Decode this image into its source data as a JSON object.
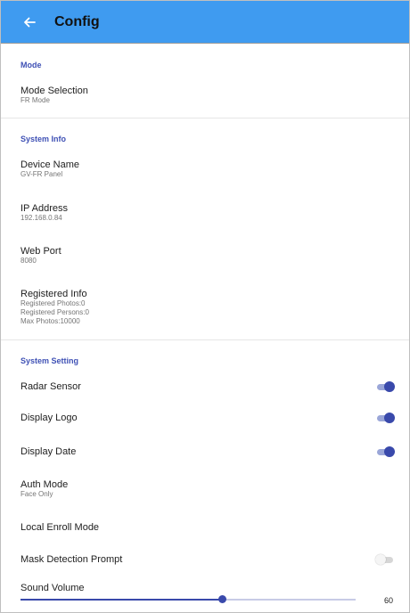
{
  "app_bar": {
    "title": "Config"
  },
  "sections": {
    "mode": {
      "header": "Mode",
      "mode_selection": {
        "title": "Mode Selection",
        "value": "FR Mode"
      }
    },
    "system_info": {
      "header": "System Info",
      "device_name": {
        "title": "Device Name",
        "value": "GV-FR Panel"
      },
      "ip_address": {
        "title": "IP Address",
        "value": "192.168.0.84"
      },
      "web_port": {
        "title": "Web Port",
        "value": "8080"
      },
      "registered_info": {
        "title": "Registered Info",
        "lines": [
          "Registered Photos:0",
          "Registered Persons:0",
          "Max Photos:10000"
        ]
      }
    },
    "system_setting": {
      "header": "System Setting",
      "radar_sensor": {
        "title": "Radar Sensor",
        "enabled": true
      },
      "display_logo": {
        "title": "Display Logo",
        "enabled": true
      },
      "display_date": {
        "title": "Display Date",
        "enabled": true
      },
      "auth_mode": {
        "title": "Auth Mode",
        "value": "Face Only"
      },
      "local_enroll_mode": {
        "title": "Local Enroll Mode"
      },
      "mask_detection_prompt": {
        "title": "Mask Detection Prompt",
        "enabled": false
      },
      "sound_volume": {
        "title": "Sound Volume",
        "value": 60,
        "level": 0.6
      }
    }
  },
  "colors": {
    "app_bar": "#3f9bf0",
    "accent": "#3949ab",
    "section_header": "#3f51b5"
  }
}
